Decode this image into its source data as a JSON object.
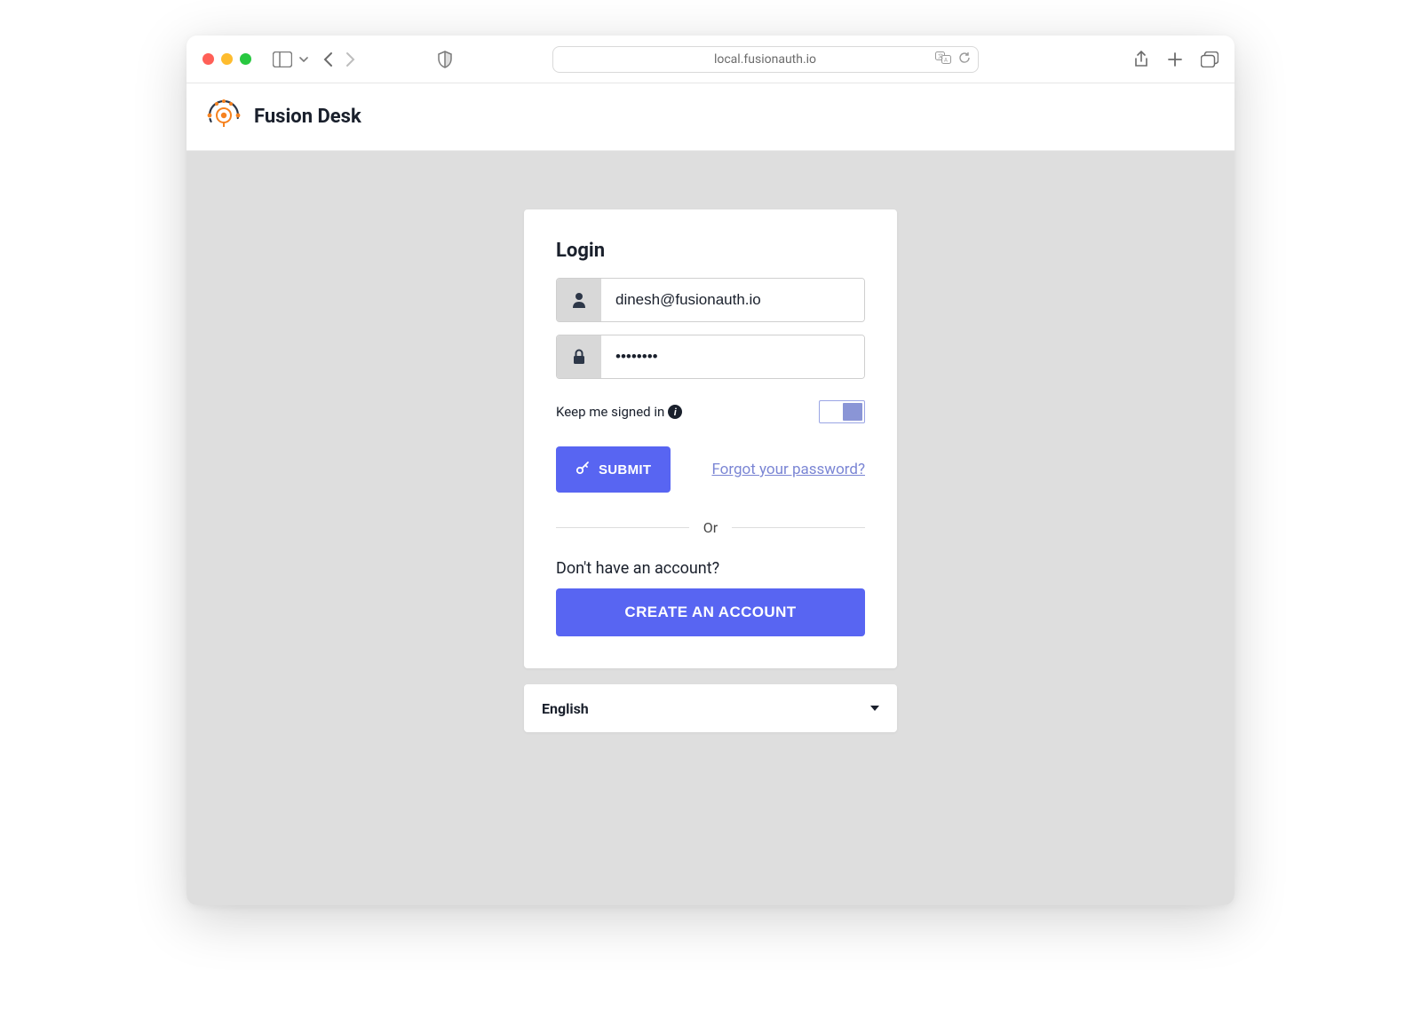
{
  "browser": {
    "address": "local.fusionauth.io"
  },
  "header": {
    "brand": "Fusion Desk"
  },
  "login": {
    "title": "Login",
    "email_value": "dinesh@fusionauth.io",
    "password_value": "••••••••",
    "keep_label": "Keep me signed in",
    "submit_label": "SUBMIT",
    "forgot_label": "Forgot your password?",
    "or_label": "Or",
    "noaccount_label": "Don't have an account?",
    "create_label": "CREATE AN ACCOUNT"
  },
  "language": {
    "selected": "English"
  }
}
